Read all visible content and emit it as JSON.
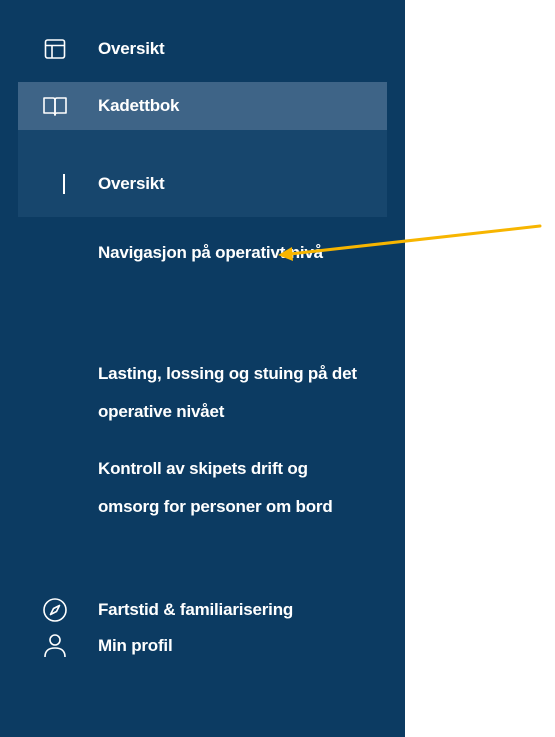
{
  "sidebar": {
    "items": [
      {
        "label": "Oversikt",
        "icon": "layout-icon"
      },
      {
        "label": "Kadettbok",
        "icon": "open-book-icon",
        "active": true
      },
      {
        "label": "Fartstid & familiarisering",
        "icon": "compass-icon"
      },
      {
        "label": "Min profil",
        "icon": "user-icon"
      }
    ],
    "kadettbok_sub": {
      "overview_label": "Oversikt",
      "chapters": [
        "Navigasjon på operativt nivå",
        "Lasting, lossing og stuing på det operative nivået",
        "Kontroll av skipets drift og omsorg for personer om bord"
      ]
    }
  },
  "colors": {
    "sidebar_bg": "#0c3b62",
    "active_item_bg": "#3e6487",
    "sub_group_bg": "#17466d",
    "text": "#ffffff",
    "annotation_arrow": "#f7b500"
  }
}
